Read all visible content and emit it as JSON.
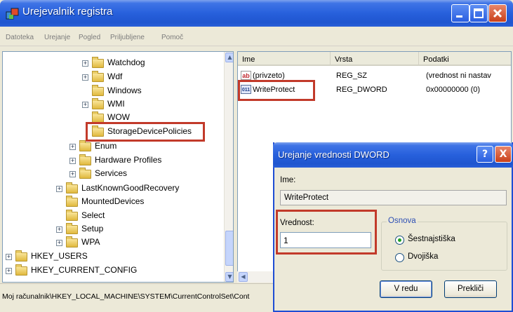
{
  "window": {
    "title": "Urejevalnik registra"
  },
  "menu": [
    "Datoteka",
    "Urejanje",
    "Pogled",
    "Priljubljene",
    "Pomoč"
  ],
  "tree": {
    "nodes": [
      {
        "label": "Watchdog",
        "expander": "+"
      },
      {
        "label": "Wdf",
        "expander": "+"
      },
      {
        "label": "Windows",
        "expander": ""
      },
      {
        "label": "WMI",
        "expander": "+"
      },
      {
        "label": "WOW",
        "expander": ""
      },
      {
        "label": "StorageDevicePolicies",
        "expander": ""
      },
      {
        "label": "Enum",
        "expander": "+"
      },
      {
        "label": "Hardware Profiles",
        "expander": "+"
      },
      {
        "label": "Services",
        "expander": "+"
      },
      {
        "label": "LastKnownGoodRecovery",
        "expander": "+"
      },
      {
        "label": "MountedDevices",
        "expander": ""
      },
      {
        "label": "Select",
        "expander": ""
      },
      {
        "label": "Setup",
        "expander": "+"
      },
      {
        "label": "WPA",
        "expander": "+"
      },
      {
        "label": "HKEY_USERS",
        "expander": "+"
      },
      {
        "label": "HKEY_CURRENT_CONFIG",
        "expander": "+"
      }
    ]
  },
  "list": {
    "columns": [
      "Ime",
      "Vrsta",
      "Podatki"
    ],
    "rows": [
      {
        "name": "(privzeto)",
        "type": "REG_SZ",
        "data": "(vrednost ni nastav",
        "icon": "ab"
      },
      {
        "name": "WriteProtect",
        "type": "REG_DWORD",
        "data": "0x00000000 (0)",
        "icon": "011"
      }
    ]
  },
  "status": "Moj računalnik\\HKEY_LOCAL_MACHINE\\SYSTEM\\CurrentControlSet\\Cont",
  "dialog": {
    "title": "Urejanje vrednosti DWORD",
    "help": "?",
    "close": "X",
    "name_label": "Ime:",
    "name_value": "WriteProtect",
    "value_label": "Vrednost:",
    "value": "1",
    "base_label": "Osnova",
    "base_options": [
      "Šestnajstiška",
      "Dvojiška"
    ],
    "base_selected": "Šestnajstiška",
    "ok": "V redu",
    "cancel": "Prekliči"
  },
  "colors": {
    "highlight": "#c23a2a",
    "titlebar": "#2760dc"
  }
}
